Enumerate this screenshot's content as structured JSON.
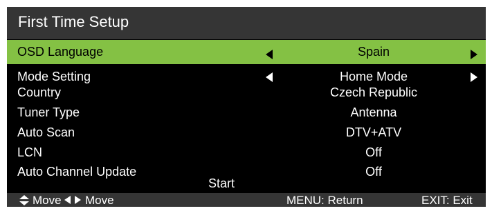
{
  "header": {
    "title": "First Time Setup"
  },
  "rows": [
    {
      "label": "OSD Language",
      "value": "Spain",
      "selected": true,
      "has_arrows": true
    },
    {
      "label": "Mode Setting",
      "value": "Home Mode",
      "has_arrows": true
    },
    {
      "label": "Country",
      "value": "Czech Republic"
    },
    {
      "label": "Tuner Type",
      "value": "Antenna"
    },
    {
      "label": "Auto Scan",
      "value": "DTV+ATV"
    },
    {
      "label": "LCN",
      "value": "Off"
    },
    {
      "label": "Auto Channel Update",
      "value": "Off"
    }
  ],
  "start_label": "Start",
  "footer": {
    "move_updown": "Move",
    "move_leftright": "Move",
    "menu_return": "MENU: Return",
    "exit": "EXIT: Exit",
    "icons": [
      "updown-arrows-icon",
      "leftright-arrows-icon"
    ]
  },
  "colors": {
    "highlight": "#84c144",
    "header_bg": "#353535",
    "background": "#000000",
    "text": "#ffffff"
  }
}
